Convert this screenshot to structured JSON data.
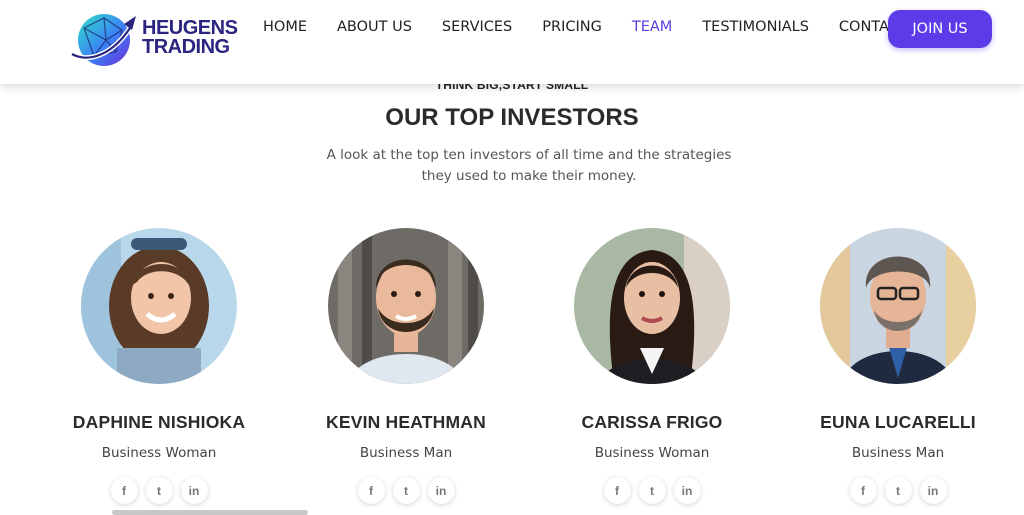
{
  "brand": {
    "line1": "HEUGENS",
    "line2": "TRADING",
    "color": "#2a2580"
  },
  "nav": {
    "items": [
      {
        "label": "HOME"
      },
      {
        "label": "ABOUT US"
      },
      {
        "label": "SERVICES"
      },
      {
        "label": "PRICING"
      },
      {
        "label": "TEAM",
        "active": true
      },
      {
        "label": "TESTIMONIALS"
      },
      {
        "label": "CONTACT"
      }
    ],
    "cta": "JOIN US",
    "accent": "#5b3ce8"
  },
  "section": {
    "tagline": "THINK BIG,START SMALL",
    "title": "OUR TOP INVESTORS",
    "subtitle": "A look at the top ten investors of all time and the strategies they used to make their money."
  },
  "team": [
    {
      "name": "DAPHINE NISHIOKA",
      "role": "Business Woman",
      "socials": [
        "facebook-icon",
        "twitter-icon",
        "linkedin-icon"
      ]
    },
    {
      "name": "KEVIN HEATHMAN",
      "role": "Business Man",
      "socials": [
        "facebook-icon",
        "twitter-icon",
        "linkedin-icon"
      ]
    },
    {
      "name": "CARISSA FRIGO",
      "role": "Business Woman",
      "socials": [
        "facebook-icon",
        "twitter-icon",
        "linkedin-icon"
      ]
    },
    {
      "name": "EUNA LUCARELLI",
      "role": "Business Man",
      "socials": [
        "facebook-icon",
        "twitter-icon",
        "linkedin-icon"
      ]
    }
  ],
  "social_glyphs": {
    "facebook": "f",
    "twitter": "t",
    "linkedin": "in"
  }
}
